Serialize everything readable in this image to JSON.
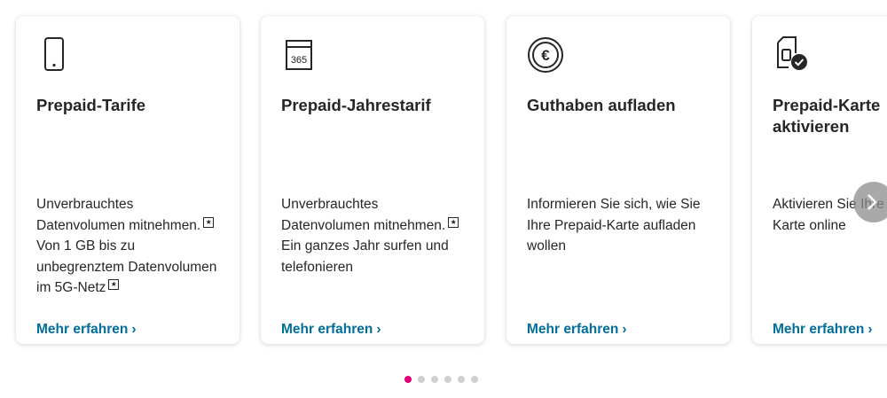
{
  "colors": {
    "accent": "#e20074",
    "link": "#006e9a",
    "text": "#262626"
  },
  "cards": [
    {
      "icon": "smartphone-icon",
      "title": "Prepaid-Tarife",
      "desc_lines": [
        "Unverbrauchtes",
        "Datenvolumen mitnehmen.",
        "Von 1 GB bis zu",
        "unbegrenztem Datenvolumen",
        "im 5G-Netz"
      ],
      "link": "Mehr erfahren"
    },
    {
      "icon": "calendar-365-icon",
      "icon_text": "365",
      "title": "Prepaid-Jahrestarif",
      "desc_lines": [
        "Unverbrauchtes",
        "Datenvolumen mitnehmen.",
        "Ein ganzes Jahr surfen und",
        "telefonieren"
      ],
      "link": "Mehr erfahren"
    },
    {
      "icon": "euro-coin-icon",
      "icon_text": "€",
      "title": "Guthaben aufladen",
      "desc_lines": [
        "Informieren Sie sich, wie Sie",
        "Ihre Prepaid-Karte aufladen",
        "wollen"
      ],
      "link": "Mehr erfahren"
    },
    {
      "icon": "sim-card-check-icon",
      "title_lines": [
        "Prepaid-Karte",
        "aktivieren"
      ],
      "desc_lines": [
        "Aktivieren Sie Ihre",
        "Karte online"
      ],
      "link": "Mehr erfahren"
    }
  ],
  "carousel": {
    "next_icon": "chevron-right-icon",
    "dot_count": 6,
    "active_index": 0
  }
}
